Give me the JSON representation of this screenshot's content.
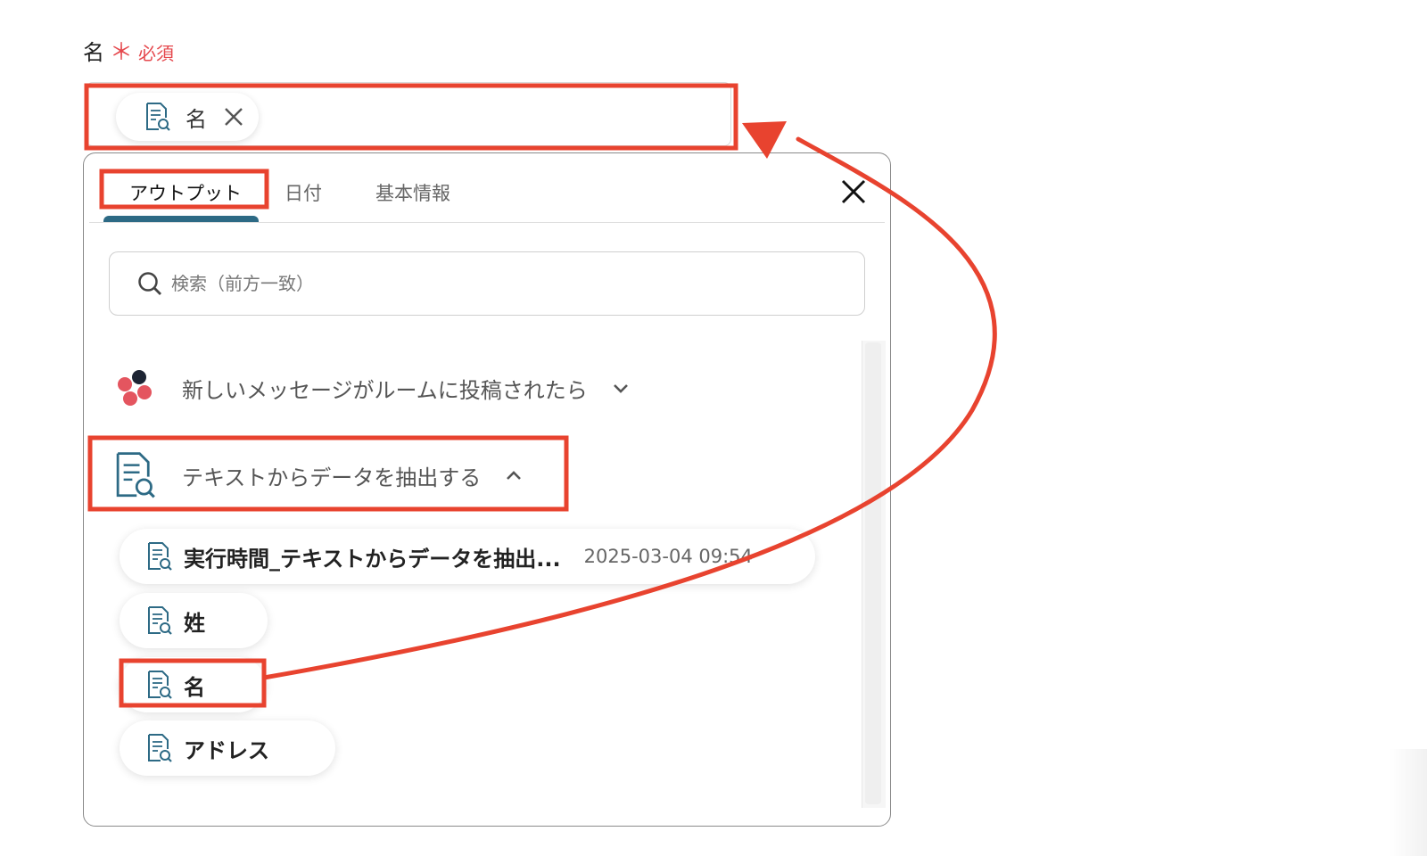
{
  "field": {
    "label": "名",
    "required_mark": "＊",
    "required_text": "必須",
    "selected_chip": {
      "icon": "document-search-icon",
      "label": "名",
      "remove_icon": "close-icon"
    }
  },
  "picker": {
    "tabs": [
      {
        "label": "アウトプット",
        "active": true
      },
      {
        "label": "日付",
        "active": false
      },
      {
        "label": "基本情報",
        "active": false
      }
    ],
    "close_icon": "close-icon",
    "search": {
      "icon": "search-icon",
      "placeholder": "検索（前方一致）",
      "value": ""
    },
    "sections": [
      {
        "title": "新しいメッセージがルームに投稿されたら",
        "icon": "app-logo-icon",
        "expanded": false,
        "chevron_icon": "chevron-down-icon"
      },
      {
        "title": "テキストからデータを抽出する",
        "icon": "document-search-icon",
        "expanded": true,
        "chevron_icon": "chevron-up-icon",
        "items": [
          {
            "label": "実行時間_テキストからデータを抽出...",
            "value": "2025-03-04 09:54"
          },
          {
            "label": "姓",
            "value": ""
          },
          {
            "label": "名",
            "value": ""
          },
          {
            "label": "アドレス",
            "value": ""
          }
        ]
      }
    ]
  },
  "colors": {
    "accent": "#2d6a85",
    "required": "#e5484d",
    "annotation": "#e8432f",
    "logo_dark": "#1d2433",
    "logo_red": "#e4555f"
  }
}
